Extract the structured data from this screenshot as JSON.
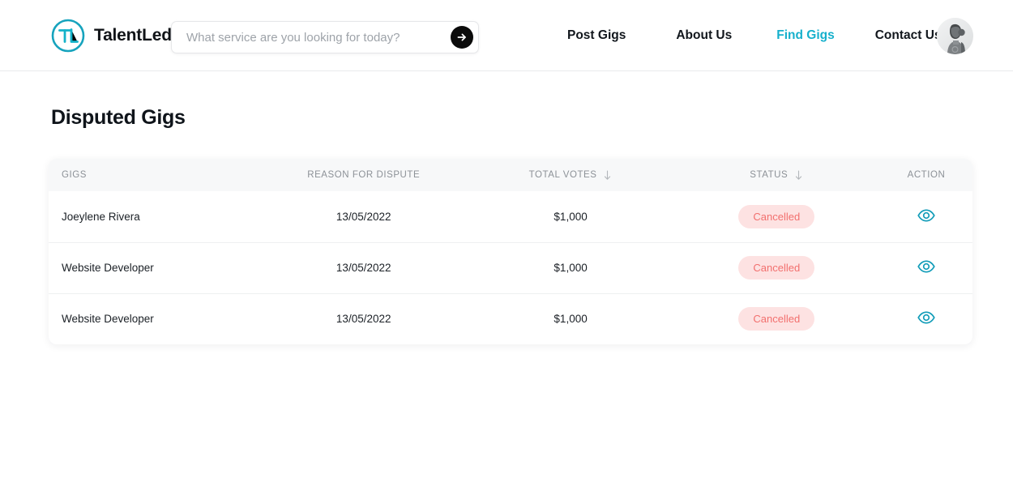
{
  "brand": {
    "name": "TalentLedger",
    "logo_text": "TL",
    "logo_color": "#16a3bd"
  },
  "search": {
    "placeholder": "What service are you looking for today?",
    "value": "",
    "submit_icon": "arrow-right-icon"
  },
  "nav": {
    "links": [
      {
        "label": "Post Gigs",
        "active": false
      },
      {
        "label": "About Us",
        "active": false
      },
      {
        "label": "Find Gigs",
        "active": true
      },
      {
        "label": "Contact Us",
        "active": false
      }
    ],
    "active_color": "#16b0cc",
    "avatar_icon": "user-avatar-photo"
  },
  "page": {
    "title": "Disputed Gigs"
  },
  "table": {
    "columns": [
      {
        "label": "GIGS",
        "sortable": false
      },
      {
        "label": "REASON FOR DISPUTE",
        "sortable": false
      },
      {
        "label": "TOTAL VOTES",
        "sortable": true
      },
      {
        "label": "STATUS",
        "sortable": true
      },
      {
        "label": "ACTION",
        "sortable": false
      }
    ],
    "sort_icon": "arrow-down-icon",
    "action_icon": "eye-icon",
    "status_colors": {
      "Cancelled": {
        "bg": "#fde2e2",
        "text": "#f2706e"
      }
    },
    "rows": [
      {
        "gig": "Joeylene Rivera",
        "reason": "13/05/2022",
        "votes": "$1,000",
        "status": "Cancelled",
        "action": "view"
      },
      {
        "gig": "Website Developer",
        "reason": "13/05/2022",
        "votes": "$1,000",
        "status": "Cancelled",
        "action": "view"
      },
      {
        "gig": "Website Developer",
        "reason": "13/05/2022",
        "votes": "$1,000",
        "status": "Cancelled",
        "action": "view"
      }
    ]
  }
}
